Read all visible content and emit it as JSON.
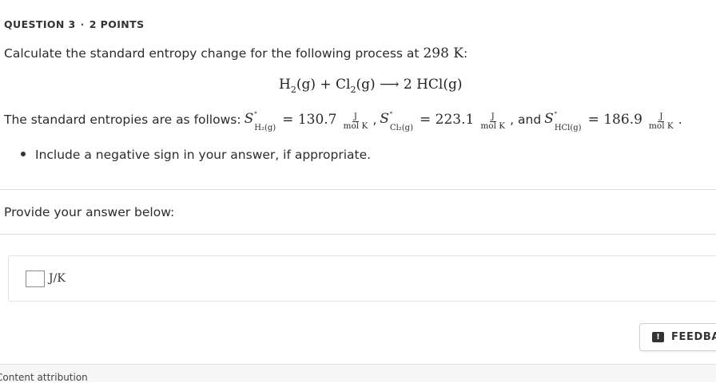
{
  "header": {
    "question_label": "QUESTION 3",
    "separator": "·",
    "points_label": "2 POINTS"
  },
  "prompt": {
    "text": "Calculate the standard entropy change for the following process at",
    "temperature": "298 K",
    "colon": ":"
  },
  "equation": {
    "h2": "H",
    "h2_sub": "2",
    "h2_state": "(g)",
    "plus": "+",
    "cl2": "Cl",
    "cl2_sub": "2",
    "cl2_state": "(g)",
    "arrow": "⟶",
    "product": "2 HCl(g)"
  },
  "entropies": {
    "intro": "The standard entropies are as follows:",
    "S": "S",
    "degree": "∘",
    "h2_sub": "H₂(g)",
    "h2_value": "= 130.7",
    "cl2_sub": "Cl₂(g)",
    "cl2_value": "= 223.1",
    "hcl_sub": "HCl(g)",
    "hcl_value": "= 186.9",
    "unit_num": "J",
    "unit_den": "mol K",
    "comma": ",",
    "and": ", and",
    "period": "."
  },
  "bullets": [
    "Include a negative sign in your answer, if appropriate."
  ],
  "answer_section": {
    "label": "Provide your answer below:",
    "input_value": "",
    "unit": "J/K"
  },
  "feedback": {
    "icon": "!",
    "label": "FEEDBA"
  },
  "footer": {
    "text": "Content attribution"
  }
}
